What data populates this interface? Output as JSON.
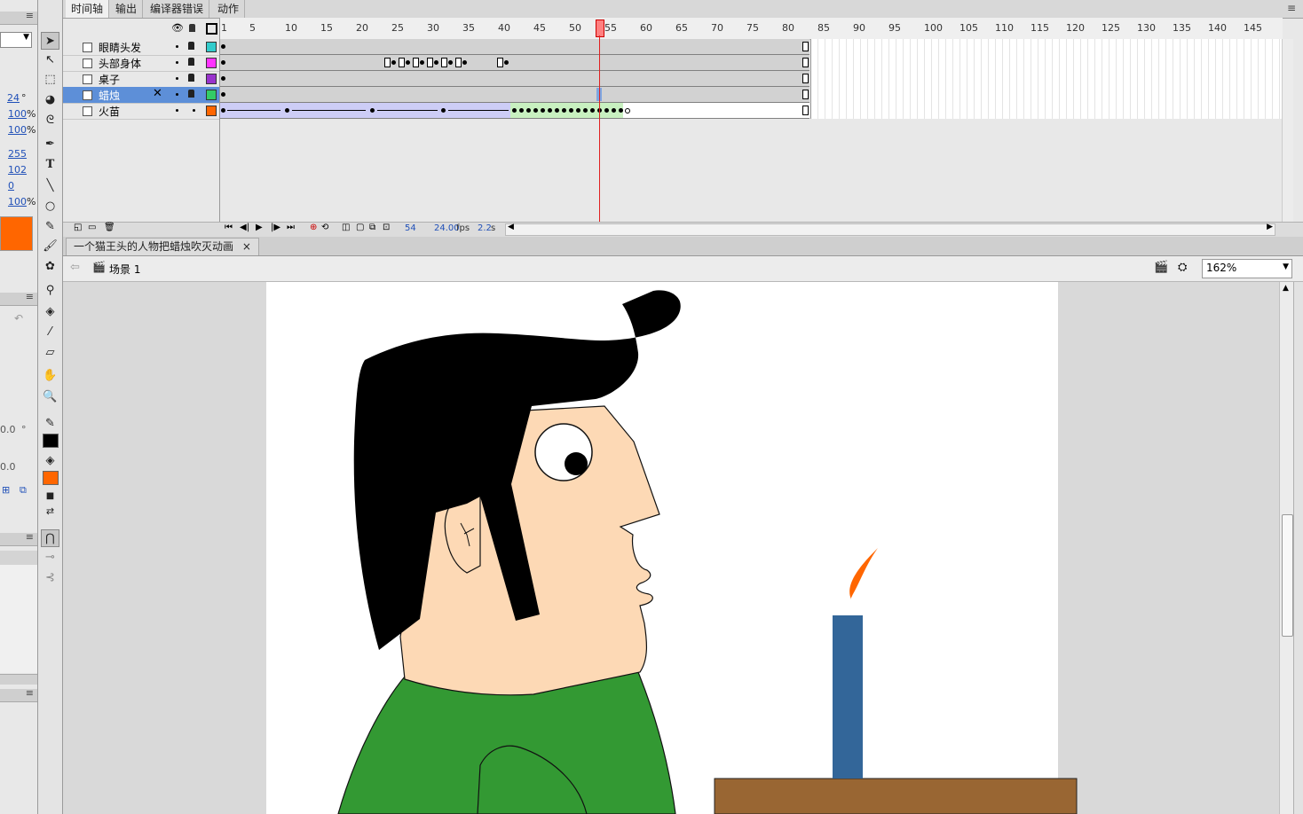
{
  "left_panel": {
    "rotation_value": "24",
    "rotation_unit": "°",
    "scale_w": "100",
    "scale_h": "100",
    "percent_unit": "%",
    "color_r": "255",
    "color_g": "102",
    "color_b": "0",
    "alpha": "100",
    "fill_color": "#ff6600",
    "value_a": "0.0",
    "value_a_unit": "°",
    "value_b": "0.0"
  },
  "timeline": {
    "tabs": [
      "时间轴",
      "输出",
      "编译器错误",
      "动作"
    ],
    "ruler": [
      "1",
      "5",
      "10",
      "15",
      "20",
      "25",
      "30",
      "35",
      "40",
      "45",
      "50",
      "55",
      "60",
      "65",
      "70",
      "75",
      "80",
      "85",
      "90",
      "95",
      "100",
      "105",
      "110",
      "115",
      "120",
      "125",
      "130",
      "135",
      "140",
      "145",
      "1"
    ],
    "layers": [
      {
        "name": "眼睛头发",
        "color": "#33cccc"
      },
      {
        "name": "头部身体",
        "color": "#ff33ff"
      },
      {
        "name": "桌子",
        "color": "#9933cc"
      },
      {
        "name": "蜡烛",
        "color": "#33cc66"
      },
      {
        "name": "火苗",
        "color": "#ff6600"
      }
    ],
    "current_frame": "54",
    "fps": "24.00",
    "fps_unit": "fps",
    "time": "2.2",
    "time_unit": "s"
  },
  "document": {
    "tab_title": "一个猫王头的人物把蜡烛吹灭动画",
    "close_label": "×",
    "scene_label": "场景 1",
    "zoom": "162%"
  },
  "colors": {
    "hair": "#000000",
    "skin": "#fdd9b5",
    "shirt": "#339933",
    "candle": "#336699",
    "flame": "#ff6600",
    "table": "#996633",
    "playhead": "#e02020"
  }
}
